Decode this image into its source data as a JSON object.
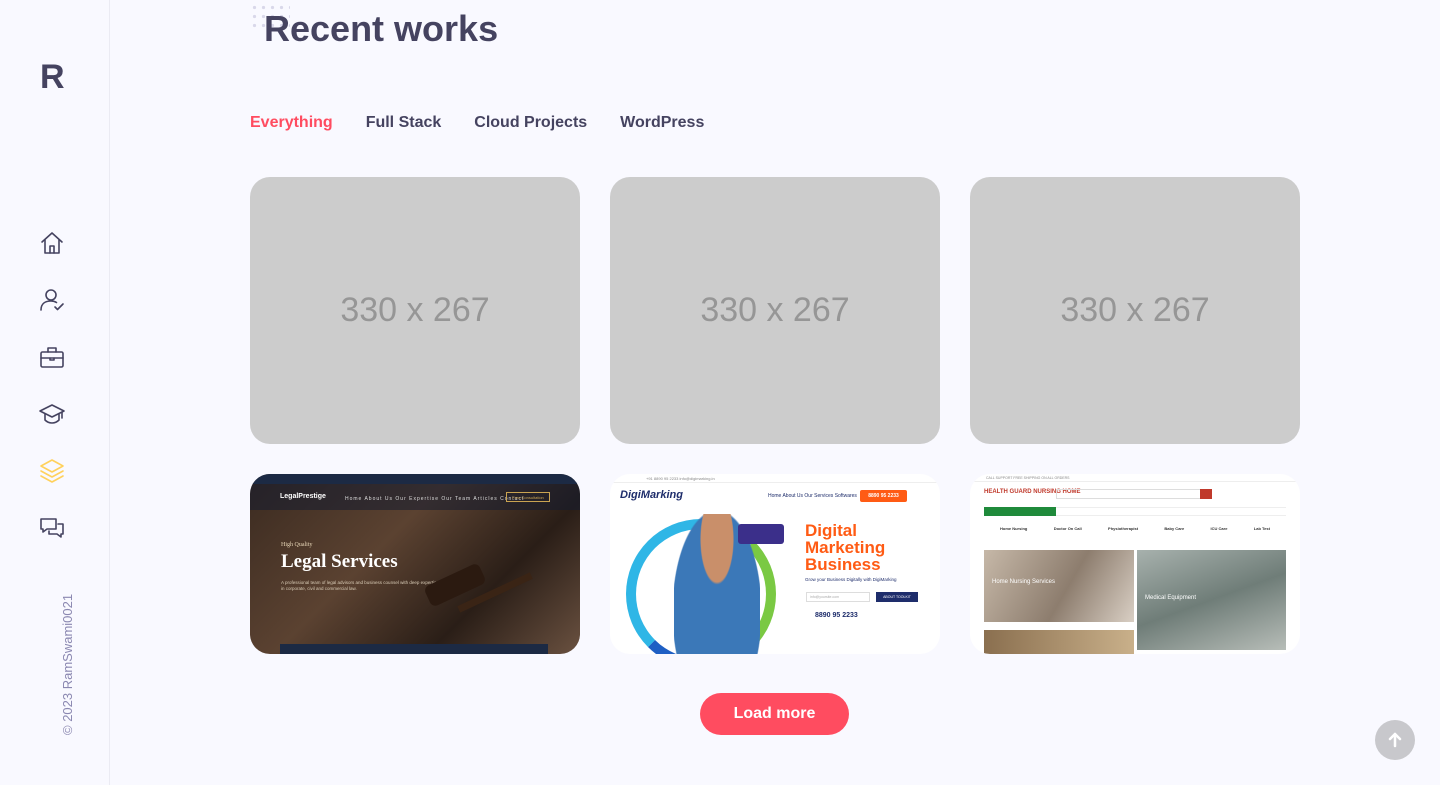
{
  "sidebar": {
    "logo": "R",
    "copyright": "© 2023 RamSwami0021",
    "nav": [
      {
        "icon": "home-icon",
        "active": false
      },
      {
        "icon": "user-check-icon",
        "active": false
      },
      {
        "icon": "briefcase-icon",
        "active": false
      },
      {
        "icon": "graduation-cap-icon",
        "active": false
      },
      {
        "icon": "layers-icon",
        "active": true
      },
      {
        "icon": "chat-bubbles-icon",
        "active": false
      }
    ],
    "active_color": "#ffd15c"
  },
  "section": {
    "title": "Recent works"
  },
  "filters": [
    "Everything",
    "Full Stack",
    "Cloud Projects",
    "WordPress"
  ],
  "filter_active": "Everything",
  "accent_color": "#ff4c60",
  "placeholders": [
    "330 x 267",
    "330 x 267",
    "330 x 267"
  ],
  "shots": {
    "legal": {
      "brand": "LegalPrestige",
      "menu": "Home   About Us   Our Expertise   Our Team   Articles   Contact",
      "cta": "Free Consultation",
      "kicker": "High Quality",
      "headline": "Legal Services",
      "desc": "A professional team of legal advisors and business counsel with deep expertise in corporate, civil and commercial law."
    },
    "digi": {
      "topbar": "+91 8890 95 2233    info@digimarking.in",
      "brand": "DigiMarking",
      "menu": "Home   About Us   Our Services   Softwares",
      "phone": "8890 95 2233",
      "headline": "Digital Marketing Business",
      "sub": "Grow your Business Digitally with DigiMarking",
      "input": "info@yoursite.com",
      "button": "ABOUT TOOLKIT",
      "number": "8890 95 2233"
    },
    "nurse": {
      "topbar": "CALL SUPPORT   FREE SHIPPING ON ALL ORDERS",
      "brand": "HEALTH GUARD NURSING HOME",
      "categories": [
        "Home Nursing",
        "Doctor On Call",
        "Physiotherapist",
        "Baby Care",
        "ICU Care",
        "Lab Test"
      ],
      "caption1": "Home Nursing Services",
      "caption2": "Medical Equipment"
    }
  },
  "load_more": "Load more",
  "scroll_top": "arrow-up-icon"
}
